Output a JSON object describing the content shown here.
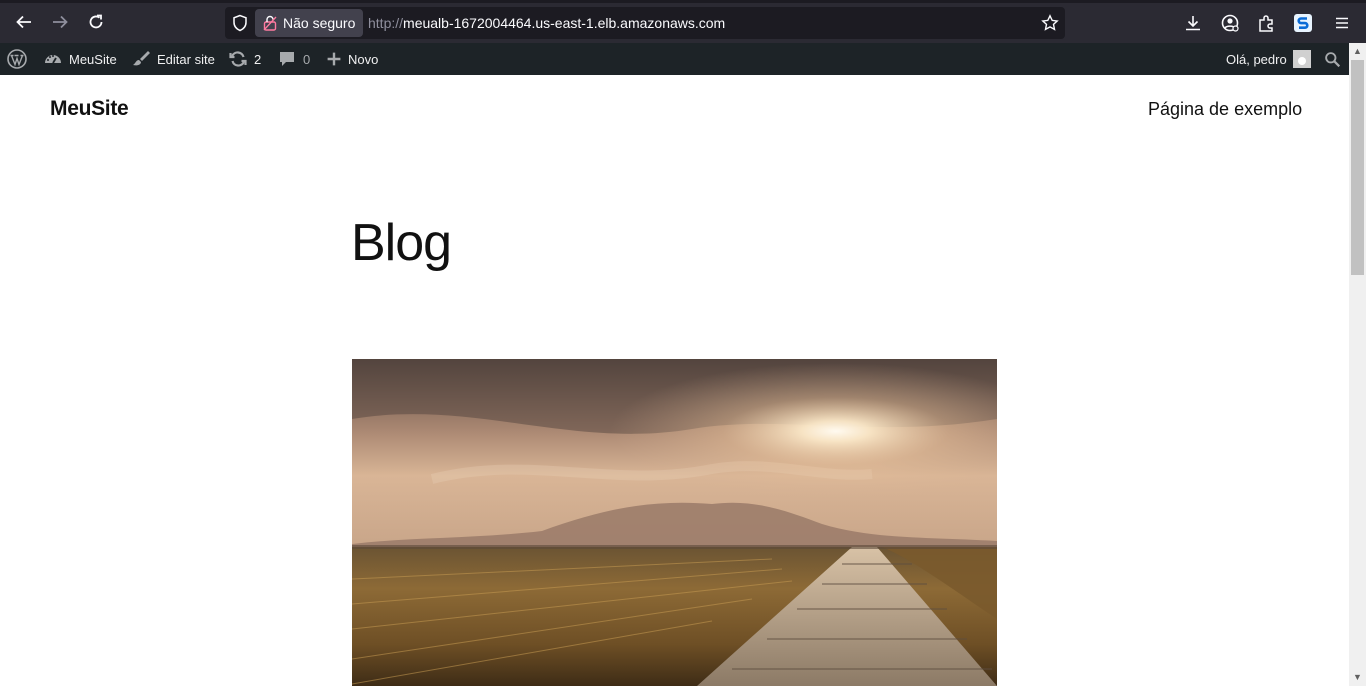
{
  "browser": {
    "security_label": "Não seguro",
    "url_scheme": "http://",
    "url_host": "meualb-1672004464.us-east-1.elb.amazonaws.com",
    "icons": [
      "back-icon",
      "forward-icon",
      "reload-icon",
      "shield-icon",
      "lock-broken-icon",
      "bookmark-star-icon",
      "download-icon",
      "account-icon",
      "extensions-icon",
      "extension-s-icon",
      "menu-icon"
    ]
  },
  "adminbar": {
    "site_label": "MeuSite",
    "edit_label": "Editar site",
    "updates_count": "2",
    "comments_count": "0",
    "new_label": "Novo",
    "greeting": "Olá, pedro"
  },
  "site": {
    "title": "MeuSite",
    "nav": [
      "Página de exemplo"
    ]
  },
  "main": {
    "heading": "Blog",
    "featured_image": "sunset-field-path"
  },
  "colors": {
    "browser_bg": "#2b2a33",
    "urlbar_bg": "#1c1b22",
    "adminbar_bg": "#1d2327",
    "page_bg": "#ffffff",
    "text": "#111111"
  }
}
